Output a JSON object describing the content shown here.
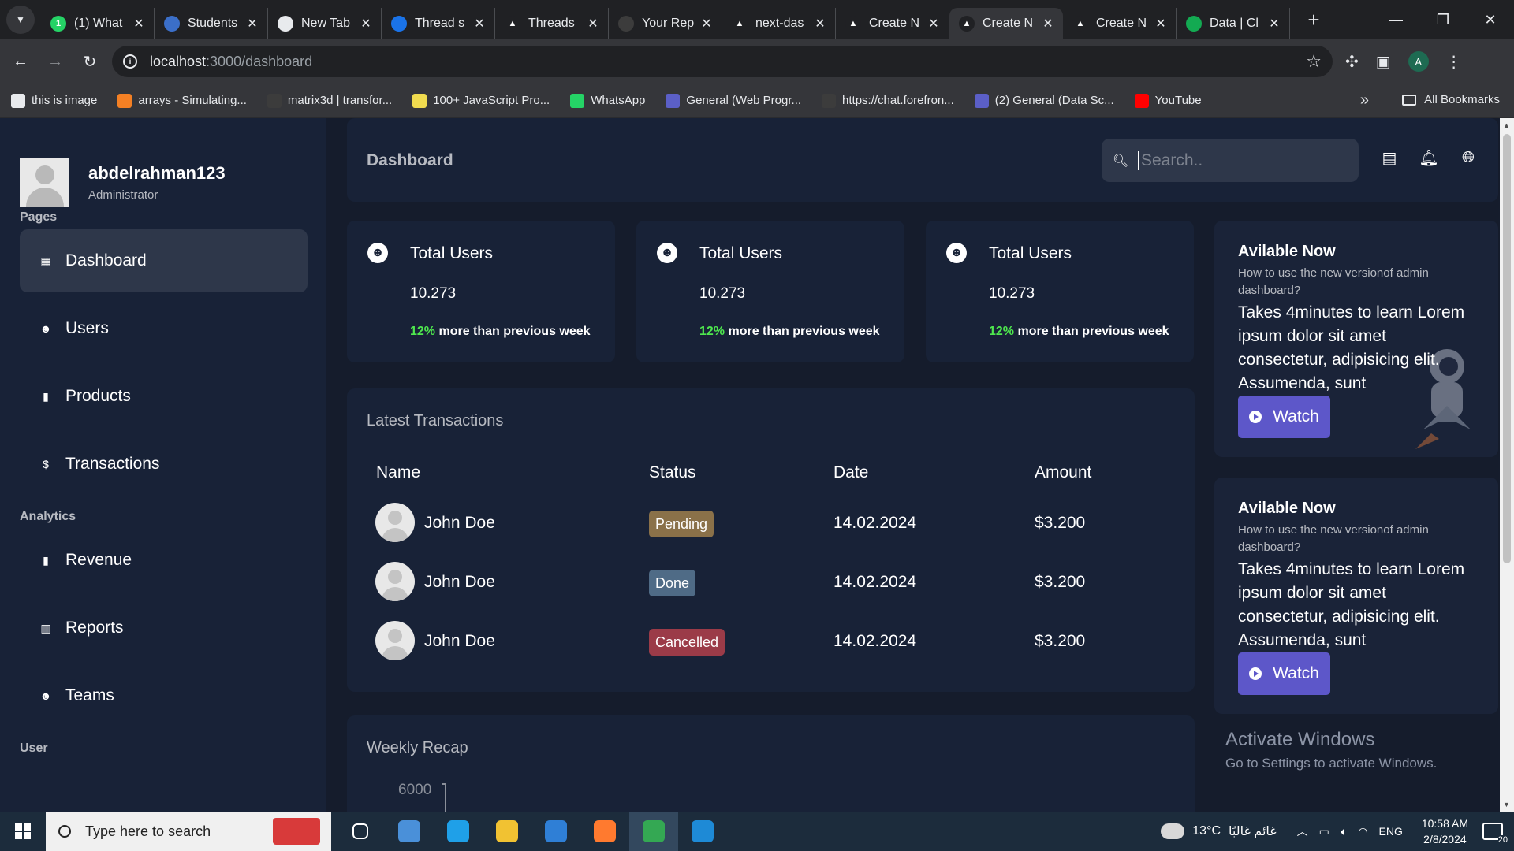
{
  "browser": {
    "tabs": [
      {
        "title": "(1) What",
        "icon": "whatsapp-icon",
        "color": "#25d366",
        "glyph": "1"
      },
      {
        "title": "Students",
        "icon": "shield-icon",
        "color": "#3b6fc9",
        "glyph": ""
      },
      {
        "title": "New Tab",
        "icon": "chrome-icon",
        "color": "#e8eaed",
        "glyph": ""
      },
      {
        "title": "Thread s",
        "icon": "thread-icon",
        "color": "#1a73e8",
        "glyph": ""
      },
      {
        "title": "Threads",
        "icon": "vercel-icon",
        "color": "#202124",
        "glyph": "▲"
      },
      {
        "title": "Your Rep",
        "icon": "github-icon",
        "color": "#3c3c3c",
        "glyph": ""
      },
      {
        "title": "next-das",
        "icon": "vercel-icon",
        "color": "#202124",
        "glyph": "▲"
      },
      {
        "title": "Create N",
        "icon": "vercel-icon",
        "color": "#202124",
        "glyph": "▲"
      },
      {
        "title": "Create N",
        "icon": "vercel-icon",
        "color": "#202124",
        "glyph": "▲"
      },
      {
        "title": "Create N",
        "icon": "vercel-icon",
        "color": "#202124",
        "glyph": "▲"
      },
      {
        "title": "Data | Cl",
        "icon": "mongodb-icon",
        "color": "#13aa52",
        "glyph": ""
      }
    ],
    "active_tab_index": 8,
    "url_host": "localhost",
    "url_path": ":3000/dashboard",
    "profile_initial": "A",
    "bookmarks": [
      {
        "label": "this is image",
        "icon": "github-icon",
        "color": "#e8eaed"
      },
      {
        "label": "arrays - Simulating...",
        "icon": "stackoverflow-icon",
        "color": "#f48024"
      },
      {
        "label": "matrix3d | transfor...",
        "icon": "css-icon",
        "color": "#3c3c3c"
      },
      {
        "label": "100+ JavaScript Pro...",
        "icon": "js-icon",
        "color": "#f0db4f"
      },
      {
        "label": "WhatsApp",
        "icon": "whatsapp-icon",
        "color": "#25d366"
      },
      {
        "label": "General (Web Progr...",
        "icon": "teams-icon",
        "color": "#5b5fc7"
      },
      {
        "label": "https://chat.forefron...",
        "icon": "forefront-icon",
        "color": "#3c3c3c"
      },
      {
        "label": "(2) General (Data Sc...",
        "icon": "teams-icon",
        "color": "#5b5fc7"
      },
      {
        "label": "YouTube",
        "icon": "youtube-icon",
        "color": "#ff0000"
      }
    ],
    "all_bookmarks": "All Bookmarks"
  },
  "sidebar": {
    "username": "abdelrahman123",
    "role": "Administrator",
    "sections": [
      {
        "title": "Pages",
        "items": [
          {
            "label": "Dashboard",
            "icon": "dashboard-icon",
            "glyph": "▦",
            "active": true
          },
          {
            "label": "Users",
            "icon": "users-icon",
            "glyph": "☻"
          },
          {
            "label": "Products",
            "icon": "bag-icon",
            "glyph": "▮"
          },
          {
            "label": "Transactions",
            "icon": "dollar-icon",
            "glyph": "$"
          }
        ]
      },
      {
        "title": "Analytics",
        "items": [
          {
            "label": "Revenue",
            "icon": "briefcase-icon",
            "glyph": "▮"
          },
          {
            "label": "Reports",
            "icon": "report-icon",
            "glyph": "▥"
          },
          {
            "label": "Teams",
            "icon": "team-icon",
            "glyph": "☻"
          }
        ]
      },
      {
        "title": "User",
        "items": []
      }
    ]
  },
  "header": {
    "title": "Dashboard",
    "search_placeholder": "Search.."
  },
  "cards": [
    {
      "title": "Total Users",
      "value": "10.273",
      "change": "12%",
      "change_text": "more than previous week"
    },
    {
      "title": "Total Users",
      "value": "10.273",
      "change": "12%",
      "change_text": "more than previous week"
    },
    {
      "title": "Total Users",
      "value": "10.273",
      "change": "12%",
      "change_text": "more than previous week"
    }
  ],
  "transactions": {
    "title": "Latest Transactions",
    "columns": [
      "Name",
      "Status",
      "Date",
      "Amount"
    ],
    "rows": [
      {
        "name": "John Doe",
        "status": "Pending",
        "status_color": "#8a7149",
        "date": "14.02.2024",
        "amount": "$3.200"
      },
      {
        "name": "John Doe",
        "status": "Done",
        "status_color": "#4f6b86",
        "date": "14.02.2024",
        "amount": "$3.200"
      },
      {
        "name": "John Doe",
        "status": "Cancelled",
        "status_color": "#9b3b48",
        "date": "14.02.2024",
        "amount": "$3.200"
      }
    ]
  },
  "weekly": {
    "title": "Weekly Recap",
    "tick": "6000"
  },
  "promos": [
    {
      "title": "Avilable Now",
      "subtitle": "How to use the new versionof admin dashboard?",
      "desc": "Takes 4minutes to learn Lorem ipsum dolor sit amet consectetur, adipisicing elit. Assumenda, sunt",
      "button": "Watch"
    },
    {
      "title": "Avilable Now",
      "subtitle": "How to use the new versionof admin dashboard?",
      "desc": "Takes 4minutes to learn Lorem ipsum dolor sit amet consectetur, adipisicing elit. Assumenda, sunt",
      "button": "Watch"
    }
  ],
  "watermark": {
    "line1": "Activate Windows",
    "line2": "Go to Settings to activate Windows."
  },
  "taskbar": {
    "search_text": "Type here to search",
    "apps": [
      {
        "name": "task-view-icon",
        "color": "#1c2c3c"
      },
      {
        "name": "store-icon",
        "color": "#4a90d9"
      },
      {
        "name": "edge-icon",
        "color": "#1fa0e8"
      },
      {
        "name": "file-explorer-icon",
        "color": "#f1c232"
      },
      {
        "name": "mail-icon",
        "color": "#2f7fd6"
      },
      {
        "name": "firefox-icon",
        "color": "#ff7a2f"
      },
      {
        "name": "chrome-icon",
        "color": "#34a853"
      },
      {
        "name": "vscode-icon",
        "color": "#1e8ad6"
      }
    ],
    "active_app_index": 6,
    "weather": "13°C",
    "weather_text": "غائم غالبًا",
    "language": "ENG",
    "time": "10:58 AM",
    "date": "2/8/2024",
    "notifications": "20"
  }
}
